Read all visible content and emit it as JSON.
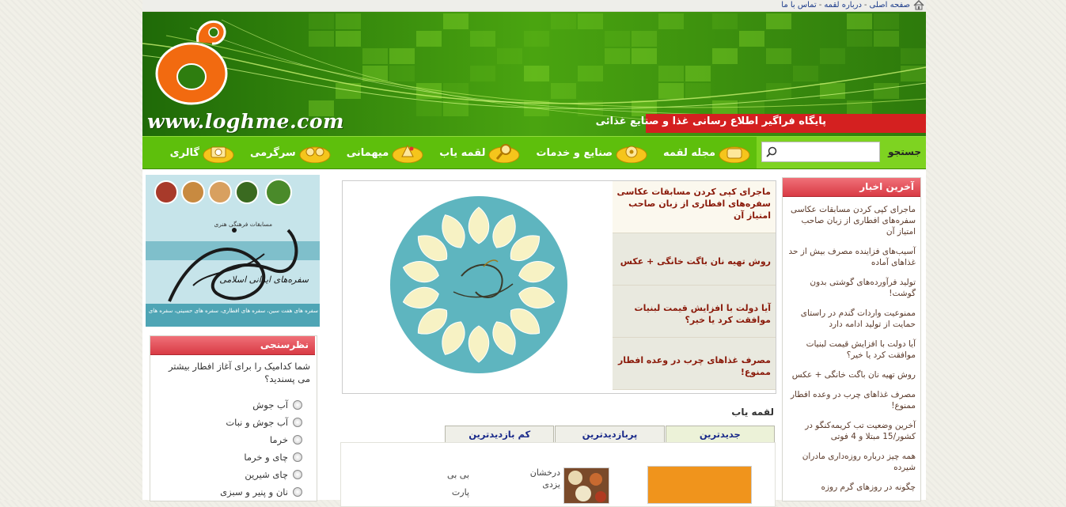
{
  "topbar": {
    "links": [
      "صفحه اصلی",
      "درباره لقمه",
      "تماس با ما"
    ],
    "separator": "-"
  },
  "header": {
    "site_url": "www.loghme.com",
    "tagline": "پایگاه فراگیر اطلاع رسانی غذا و صنایع غذائی"
  },
  "nav": {
    "search_label": "جستجو",
    "search_value": "",
    "items": [
      "مجله لقمه",
      "صنایع و خدمات",
      "لقمه یاب",
      "میهمانی",
      "سرگرمی",
      "گالری"
    ]
  },
  "news": {
    "title": "آخرین اخبار",
    "items": [
      "ماجرای کپی کردن مسابقات عکاسی سفره‌های افطاری از زبان صاحب امتیاز آن",
      "آسیب‌های فزاینده مصرف بیش از حد غذاهای آماده",
      "تولید فرآورده‌های گوشتی بدون گوشت!",
      "ممنوعیت واردات گندم در راستای حمایت از تولید ادامه دارد",
      "آیا دولت با افزایش قیمت لبنیات موافقت کرد یا خیر؟",
      "روش تهیه نان باگت خانگی + عکس",
      "مصرف غذاهای چرب در وعده افطار ممنوع!",
      "آخرین وضعیت تب کریمه‌کنگو در کشور/15 مبتلا و 4 فوتی",
      "همه چیز درباره روزه‌داری مادران شیرده",
      "چگونه در روزهای گرم روزه"
    ]
  },
  "featured": {
    "items": [
      "ماجرای کپی کردن مسابقات عکاسی سفره‌های افطاری از زبان صاحب امتیاز آن",
      "روش تهیه نان باگت خانگی + عکس",
      "آیا دولت با افزایش قیمت لبنیات موافقت کرد یا خیر؟",
      "مصرف غذاهای چرب در وعده افطار ممنوع!"
    ]
  },
  "loghmeyab": {
    "title": "لقمه یاب",
    "tabs": [
      "جدیدترین",
      "پربازدیدترین",
      "کم بازدیدترین"
    ],
    "entries": [
      {
        "line1": "درخشان",
        "line2": "یزدی"
      },
      {
        "line1": "بی بی",
        "line2": "پارت"
      }
    ]
  },
  "promo": {
    "subtitle": "مسابقات فرهنگی هنری",
    "calligraphy": "سفره‌های ایرانی اسلامی",
    "footer": "سفره های هفت سین، سفره های افطاری، سفره های حسینی، سفره های یلدا"
  },
  "poll": {
    "title": "نظرسنجی",
    "question": "شما کدامیک را برای آغاز افطار بیشتر می پسندید؟",
    "options": [
      "آب جوش",
      "آب جوش و نبات",
      "خرما",
      "چای و خرما",
      "چای شیرین",
      "نان و پنیر و سبزی"
    ]
  },
  "colors": {
    "nav_green": "#5ebf0c",
    "header_red": "#d42020",
    "box_head": "#e8505a",
    "logo_orange": "#f26a10"
  }
}
